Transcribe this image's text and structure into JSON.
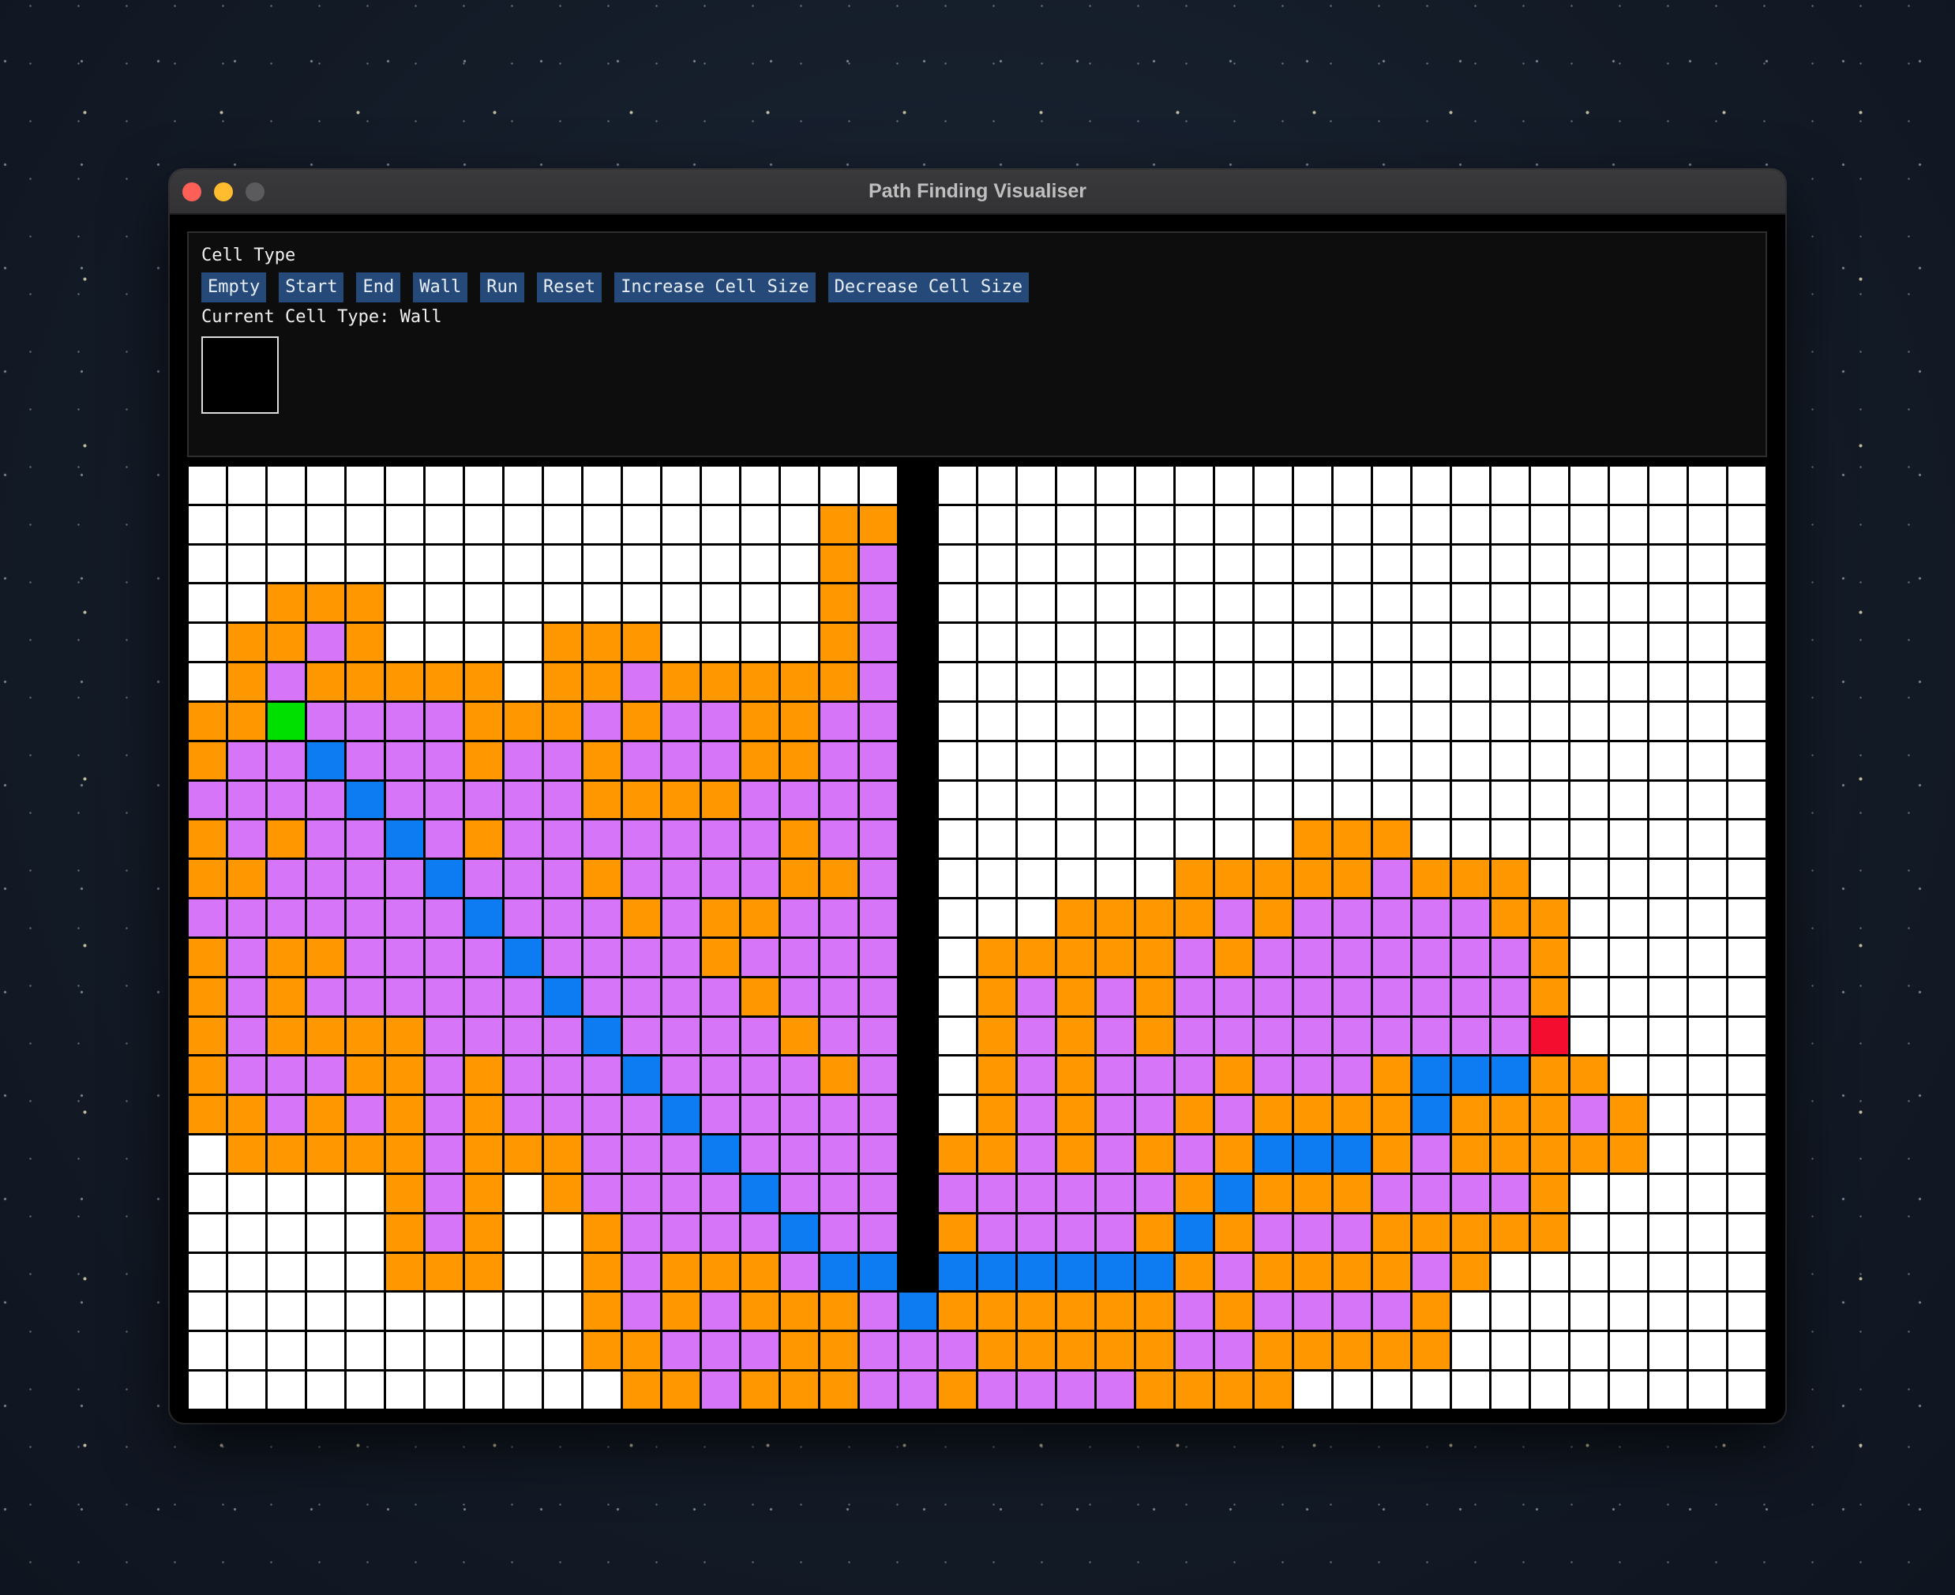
{
  "window": {
    "title": "Path Finding Visualiser"
  },
  "controls": {
    "header": "Cell Type",
    "buttons": [
      {
        "label": "Empty",
        "name": "empty-button"
      },
      {
        "label": "Start",
        "name": "start-button"
      },
      {
        "label": "End",
        "name": "end-button"
      },
      {
        "label": "Wall",
        "name": "wall-button"
      },
      {
        "label": "Run",
        "name": "run-button"
      },
      {
        "label": "Reset",
        "name": "reset-button"
      },
      {
        "label": "Increase Cell Size",
        "name": "increase-cell-size-button"
      },
      {
        "label": "Decrease Cell Size",
        "name": "decrease-cell-size-button"
      }
    ],
    "current_label": "Current Cell Type: Wall",
    "current_color": "#000000"
  },
  "grid": {
    "cols": 40,
    "rows": 24,
    "legend": {
      ".": {
        "type": "empty",
        "color": "#ffffff"
      },
      "W": {
        "type": "wall",
        "color": "#000000"
      },
      "O": {
        "type": "frontier",
        "color": "#ff9800"
      },
      "V": {
        "type": "visited",
        "color": "#d775f9"
      },
      "P": {
        "type": "path",
        "color": "#0d7cf2"
      },
      "S": {
        "type": "start",
        "color": "#00e000"
      },
      "E": {
        "type": "end",
        "color": "#f50d30"
      }
    },
    "cells": [
      "..................W.....................",
      "................OOW.....................",
      "................OVW.....................",
      "..OOO...........OVW.....................",
      ".OOVO....OOO....OVW.....................",
      ".OVOOOOO.OOVOOOOOVW.....................",
      "OOSVVVVOOOVOVVOOVVW.....................",
      "OVVPVVVOVVOVVVOOVVW.....................",
      "VVVVPVVVVVOOOOVVVVW.....................",
      "OVOVVPVOVVVVVVVOVVW.........OOO.........",
      "OOVVVVPVVVOVVVVOOVW......OOOOOVOOO......",
      "VVVVVVVPVVVOVOOVVVW...OOOOVOVVVVVOO.....",
      "OVOOVVVVPVVVVOVVVVW.OOOOOVOVVVVVVVO.....",
      "OVOVVVVVVPVVVVOVVVW.OVOVOVVVVVVVVVO.....",
      "OVOOOOVVVVPVVVVOVVW.OVOVOVVVVVVVVVE.....",
      "OVVVOOVOVVVPVVVVOVW.OVOVVVOVVVOPPPOO....",
      "OOVOVOVOVVVVPVVVVVW.OVOVVOVOOOOPOOOVO...",
      ".OOOOOVOOOVVVPVVVVWOOVOVOVOPPPOVOOOOO...",
      ".....OVO.OVVVVPVVVWVVVVVVOPOOOVVVVO.....",
      ".....OVO..OVVVVPVVWOVVVVOPOVVVOOOOO.....",
      ".....OOO..OVOOOVPPWPPPPPPOVOOOOVO.......",
      "..........OVOVOOOVPOOOOOOVOVVVVO........",
      "..........OOVVVOOVVVOOOOOVVOOOOO........",
      "...........OOVOOOVVOVVVVOOOO............"
    ]
  }
}
